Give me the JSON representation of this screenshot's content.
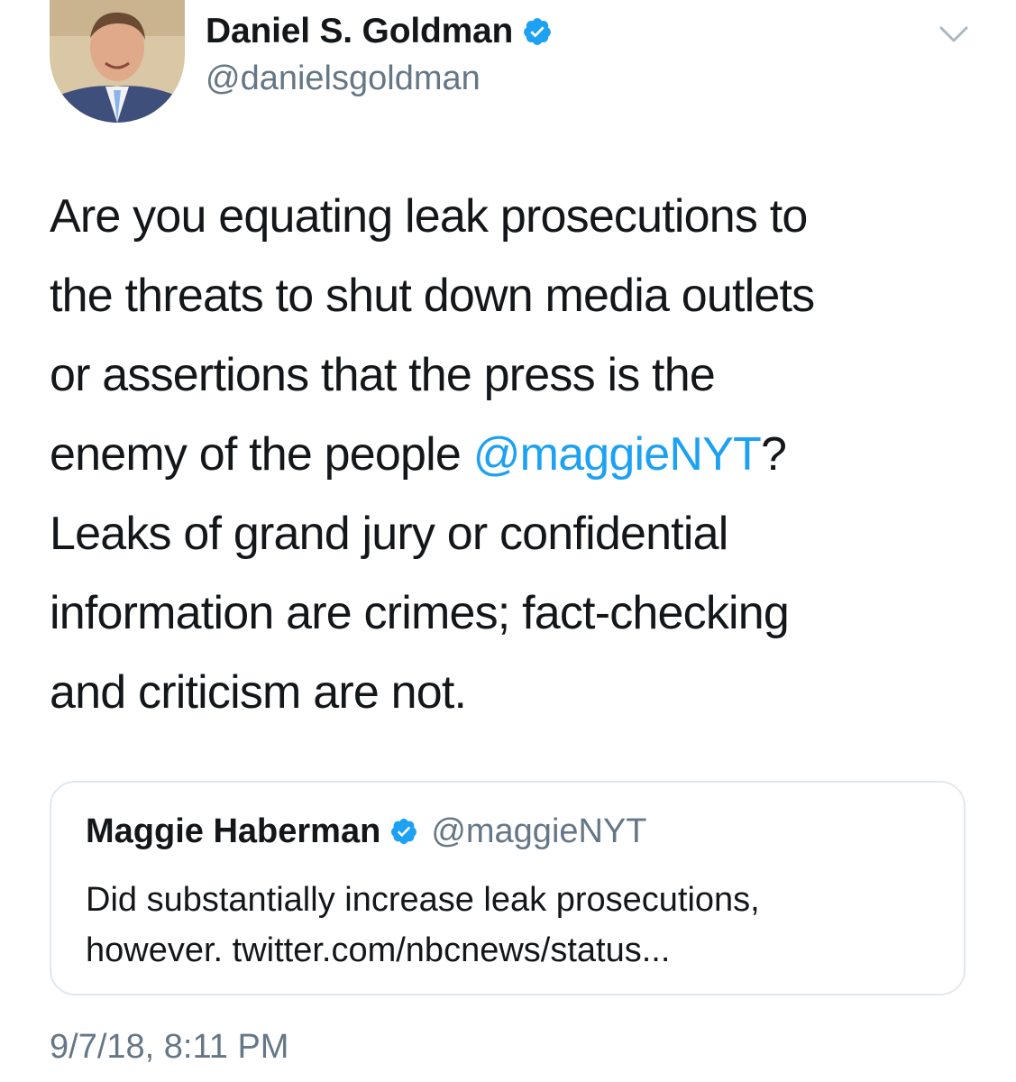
{
  "author": {
    "name": "Daniel S. Goldman",
    "handle": "@danielsgoldman",
    "verified_icon": "verified-badge-icon"
  },
  "tweet": {
    "lines": [
      {
        "text": "Are you equating leak prosecutions to"
      },
      {
        "text": "the threats to shut down media outlets"
      },
      {
        "text": "or assertions that the press is the"
      },
      {
        "pre": "enemy of the people ",
        "mention": "@maggieNYT",
        "post": "?"
      },
      {
        "text": "Leaks of grand jury or confidential"
      },
      {
        "text": "information are crimes; fact-checking"
      },
      {
        "text": "and criticism are not."
      }
    ],
    "timestamp": "9/7/18, 8:11 PM"
  },
  "quoted_tweet": {
    "name": "Maggie Haberman",
    "handle": "@maggieNYT",
    "lines": [
      "Did substantially increase leak prosecutions,",
      "however. twitter.com/nbcnews/status..."
    ]
  },
  "colors": {
    "link": "#1da1f2",
    "secondary_text": "#657786",
    "border": "#e1e8ed"
  }
}
